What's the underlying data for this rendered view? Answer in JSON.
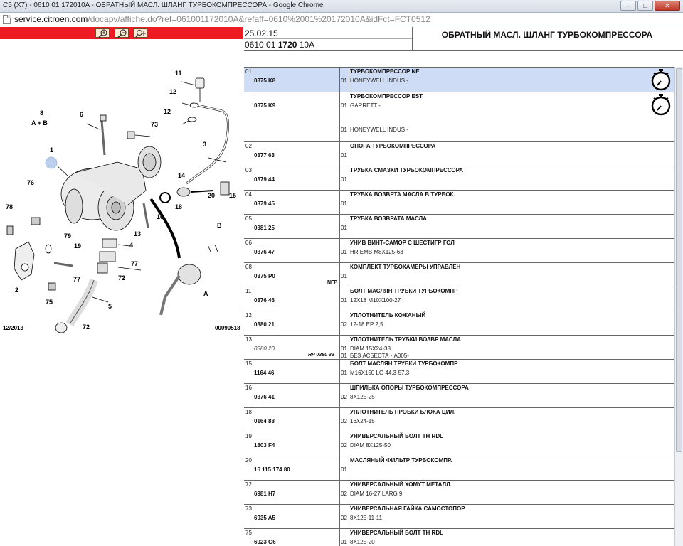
{
  "window": {
    "title": "C5 (X7) - 0610 01 172010A - ОБРАТНЫЙ МАСЛ. ШЛАНГ ТУРБОКОМПРЕССОРА - Google Chrome",
    "url_host": "service.citroen.com",
    "url_path": "/docapv/affiche.do?ref=061001172010A&refaff=0610%2001%20172010A&idFct=FCT0512",
    "controls": {
      "minimize": "–",
      "maximize": "□",
      "close": "✕"
    },
    "page_icon": "page-icon"
  },
  "toolbar": {
    "zoom_in": "zoom-in-icon",
    "zoom_out": "zoom-out-icon",
    "zoom_move": "zoom-pan-icon"
  },
  "diagram": {
    "labels": [
      "11",
      "12",
      "12",
      "6",
      "8",
      "A + B",
      "73",
      "1",
      "3",
      "76",
      "78",
      "14",
      "20",
      "15",
      "18",
      "16",
      "79",
      "19",
      "13",
      "4",
      "77",
      "B",
      "77",
      "72",
      "2",
      "75",
      "5",
      "A",
      "72"
    ],
    "date": "12/2013",
    "code": "00090518"
  },
  "header": {
    "date": "25.02.15",
    "ref_prefix": "0610 01 ",
    "ref_bold": "1720",
    "ref_suffix": " 10A",
    "title": "ОБРАТНЫЙ МАСЛ. ШЛАНГ ТУРБОКОМПРЕССОРА"
  },
  "table": {
    "timer_icon": "stopwatch-icon",
    "rows": [
      {
        "idx": "01",
        "code": "0375 K8",
        "qty": "01",
        "name": "ТУРБОКОМПРЕССОР NE",
        "desc": "HONEYWELL INDUS -",
        "timer": true,
        "selected": true
      },
      {
        "idx": "",
        "code": "0375 K9",
        "qty": "01",
        "qty2": "01",
        "name": "ТУРБОКОМПРЕССОР EST",
        "desc": "GARRETT -",
        "desc2": "HONEYWELL INDUS -",
        "timer": true
      },
      {
        "idx": "02",
        "code": "0377 63",
        "qty": "01",
        "name": "ОПОРА ТУРБОКОМПРЕССОРА",
        "desc": ""
      },
      {
        "idx": "03",
        "code": "0379 44",
        "qty": "01",
        "name": "ТРУБКА СМАЗКИ ТУРБОКОМПРЕССОРА",
        "desc": ""
      },
      {
        "idx": "04",
        "code": "0379 45",
        "qty": "01",
        "name": "ТРУБКА ВОЗВРТА МАСЛА В ТУРБОК.",
        "desc": ""
      },
      {
        "idx": "05",
        "code": "0381 25",
        "qty": "01",
        "name": "ТРУБКА ВОЗВРАТА МАСЛА",
        "desc": ""
      },
      {
        "idx": "06",
        "code": "0376 47",
        "qty": "01",
        "name": "УНИВ ВИНТ-САМОР С ШЕСТИГР ГОЛ",
        "desc": "HR EMB M8X125-63"
      },
      {
        "idx": "08",
        "code": "0375 P0",
        "qty": "01",
        "name": "КОМПЛЕКТ ТУРБОКАМЕРЫ УПРАВЛЕН",
        "desc": "",
        "nfp": "NFP"
      },
      {
        "idx": "11",
        "code": "0376 46",
        "qty": "01",
        "name": "БОЛТ МАСЛЯН ТРУБКИ ТУРБОКОМПР",
        "desc": "12X18 M10X100-27"
      },
      {
        "idx": "12",
        "code": "0380 21",
        "qty": "02",
        "name": "УПЛОТНИТЕЛЬ КОЖАНЫЙ",
        "desc": "12-18 EP 2,5"
      },
      {
        "idx": "13",
        "code": "0380 20",
        "code_italic": true,
        "qty": "01",
        "qty2": "01",
        "name": "УПЛОТНИТЕЛЬ ТРУБКИ ВОЗВР МАСЛА",
        "desc": "DIAM 15X24-38",
        "desc2": "БЕЗ АСБЕСТА - A005-",
        "rp": "RP 0380 33"
      },
      {
        "idx": "15",
        "code": "1164 46",
        "qty": "01",
        "name": "БОЛТ МАСЛЯН ТРУБКИ ТУРБОКОМПР",
        "desc": "M16X150 LG 44,3-57,3"
      },
      {
        "idx": "16",
        "code": "0376 41",
        "qty": "02",
        "name": "ШПИЛЬКА ОПОРЫ ТУРБОКОМПРЕССОРА",
        "desc": "8X125-25"
      },
      {
        "idx": "18",
        "code": "0164 88",
        "qty": "02",
        "name": "УПЛОТНИТЕЛЬ ПРОБКИ БЛОКА ЦИЛ.",
        "desc": "16X24-15"
      },
      {
        "idx": "19",
        "code": "1803 F4",
        "qty": "02",
        "name": "УНИВЕРСАЛЬНЫЙ БОЛТ TH RDL",
        "desc": "DIAM 8X125-50"
      },
      {
        "idx": "20",
        "code": "16 115 174 80",
        "qty": "01",
        "name": "МАСЛЯНЫЙ ФИЛЬТР ТУРБОКОМПР.",
        "desc": ""
      },
      {
        "idx": "72",
        "code": "6981 H7",
        "qty": "02",
        "name": "УНИВЕРСАЛЬНЫЙ ХОМУТ МЕТАЛЛ.",
        "desc": "DIAM 16-27 LARG 9"
      },
      {
        "idx": "73",
        "code": "6935 A5",
        "qty": "02",
        "name": "УНИВЕРСАЛЬНАЯ ГАЙКА САМОСТОПОР",
        "desc": "8X125-11-11"
      },
      {
        "idx": "75",
        "code": "6923 G6",
        "qty": "01",
        "name": "УНИВЕРСАЛЬНЫЙ БОЛТ TH RDL",
        "desc": "8X125-20"
      }
    ]
  }
}
